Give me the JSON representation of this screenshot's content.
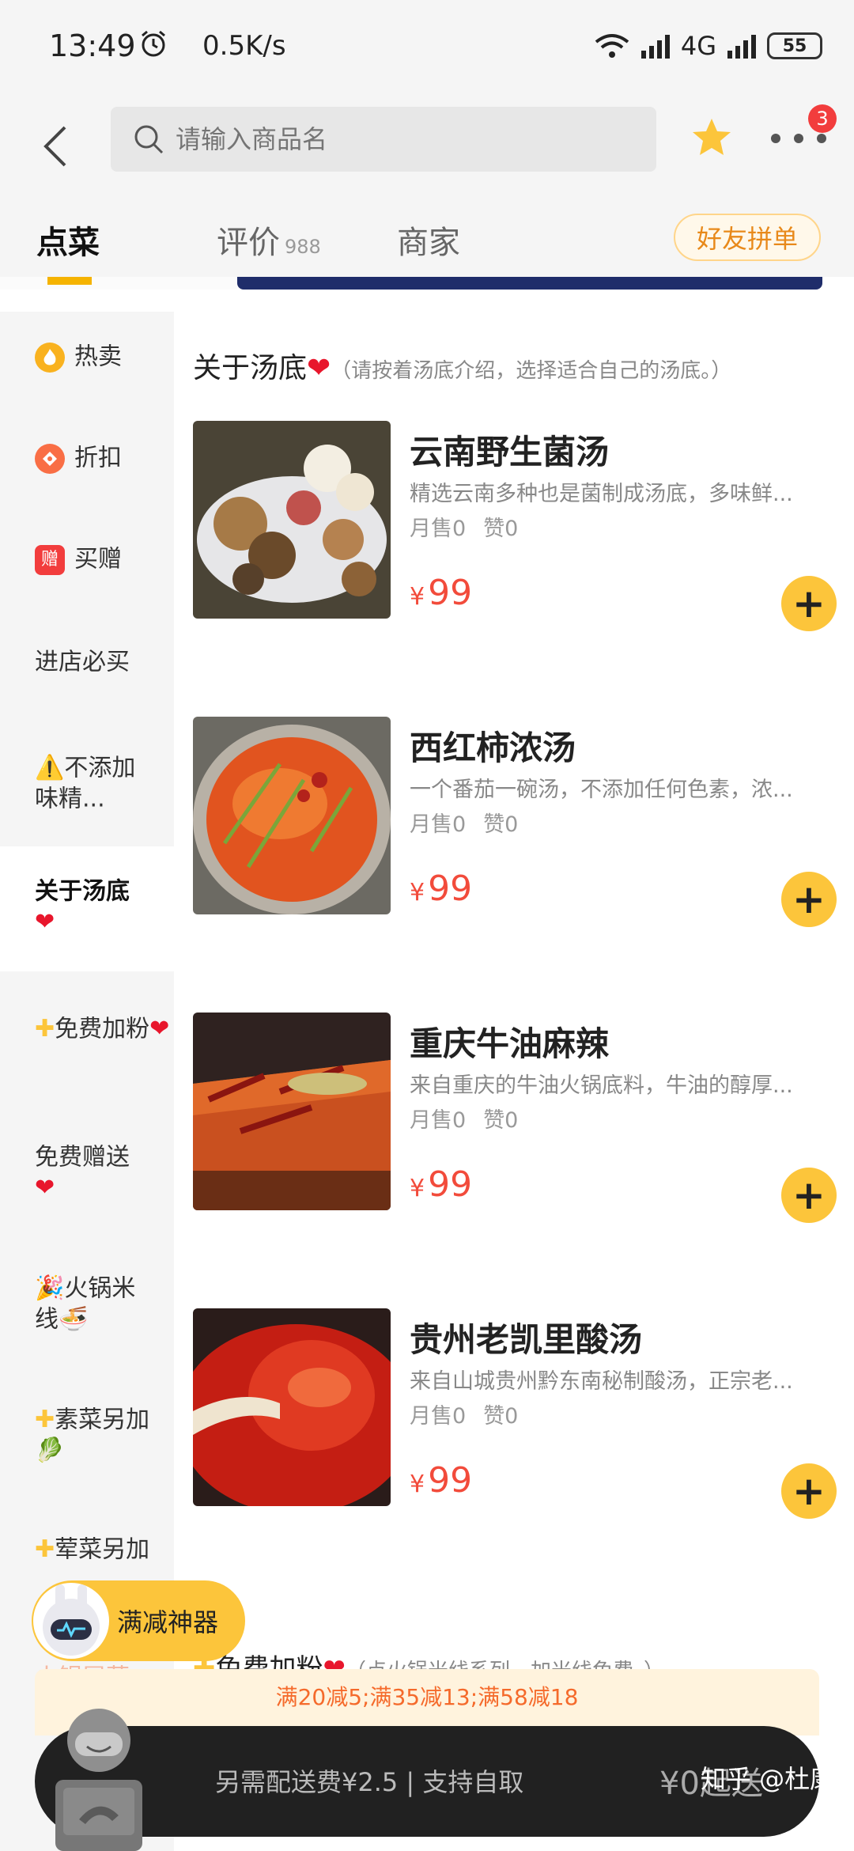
{
  "status_bar": {
    "time": "13:49",
    "speed": "0.5K/s",
    "network": "4G",
    "battery": "55"
  },
  "header": {
    "search_placeholder": "请输入商品名",
    "more_badge": "3"
  },
  "tabs": {
    "order": "点菜",
    "reviews": "评价",
    "reviews_count": "988",
    "merchant": "商家",
    "group_order": "好友拼单"
  },
  "sidebar": {
    "items": [
      {
        "label": "热卖"
      },
      {
        "label": "折扣"
      },
      {
        "label": "买赠",
        "icon_text": "赠"
      },
      {
        "label": "进店必买"
      },
      {
        "label": "不添加味精..."
      },
      {
        "label": "关于汤底"
      },
      {
        "label": "免费加粉"
      },
      {
        "label": "免费赠送"
      },
      {
        "label": "火锅米线"
      },
      {
        "label": "素菜另加"
      },
      {
        "label": "荤菜另加"
      },
      {
        "label": "火锅冒菜"
      }
    ]
  },
  "section": {
    "title": "关于汤底",
    "note": "（请按着汤底介绍，选择适合自己的汤底。）"
  },
  "dishes": [
    {
      "name": "云南野生菌汤",
      "desc": "精选云南多种也是菌制成汤底，多味鲜...",
      "sold": "月售0",
      "likes": "赞0",
      "currency": "¥",
      "price": "99"
    },
    {
      "name": "西红柿浓汤",
      "desc": "一个番茄一碗汤，不添加任何色素，浓...",
      "sold": "月售0",
      "likes": "赞0",
      "currency": "¥",
      "price": "99"
    },
    {
      "name": "重庆牛油麻辣",
      "desc": "来自重庆的牛油火锅底料，牛油的醇厚...",
      "sold": "月售0",
      "likes": "赞0",
      "currency": "¥",
      "price": "99"
    },
    {
      "name": "贵州老凯里酸汤",
      "desc": "来自山城贵州黔东南秘制酸汤，正宗老...",
      "sold": "月售0",
      "likes": "赞0",
      "currency": "¥",
      "price": "99"
    }
  ],
  "section2": {
    "title": "免费加粉",
    "note": "（点火锅米线系列，加米线免费。）"
  },
  "helper": {
    "label": "满减神器"
  },
  "promo": {
    "text": "满20减5;满35减13;满58减18"
  },
  "cart": {
    "info": "另需配送费¥2.5 | 支持自取",
    "min_order": "¥0起送"
  },
  "watermark": "知乎 @杜康",
  "colors": {
    "accent": "#fcc53b",
    "price": "#f24b3b",
    "promo_text": "#f56a2b",
    "cart_bg": "#212121"
  }
}
